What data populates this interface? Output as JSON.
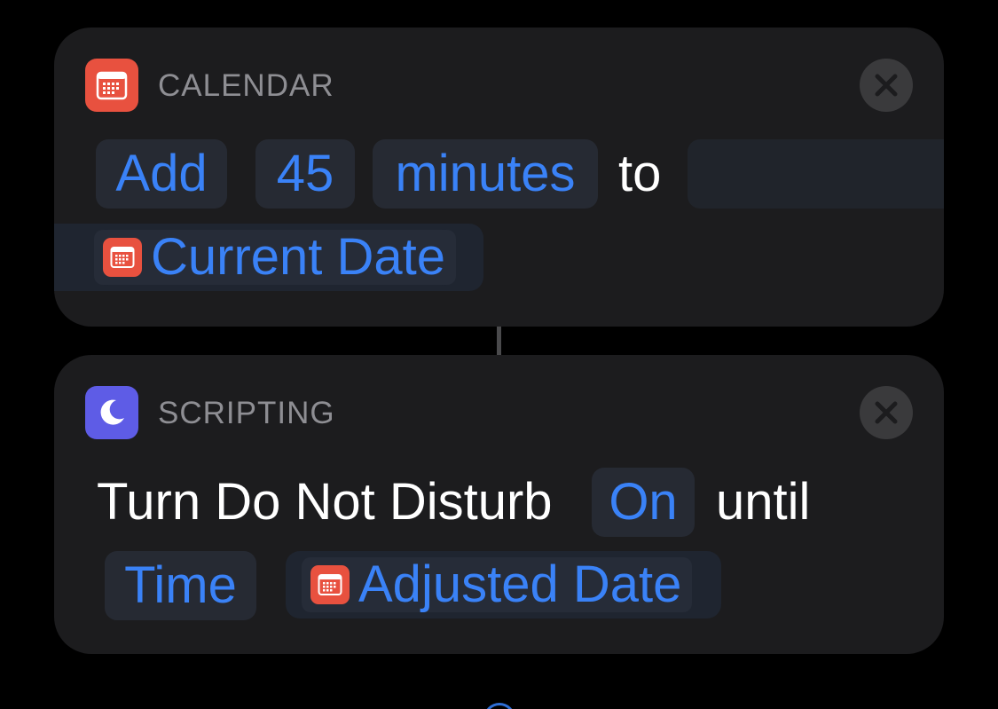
{
  "colors": {
    "background": "#000000",
    "card": "#1c1c1e",
    "token_text": "#3a82f7",
    "calendar_icon": "#e8513f",
    "scripting_icon": "#5e5ce6",
    "header_text": "#8e8e93"
  },
  "calendar_action": {
    "category": "CALENDAR",
    "icon": "calendar-icon",
    "operation_token": "Add",
    "amount_token": "45",
    "unit_token": "minutes",
    "connector_word": "to",
    "date_variable": {
      "label": "Current Date",
      "icon": "calendar-icon"
    },
    "close_icon": "close-icon"
  },
  "scripting_action": {
    "category": "SCRIPTING",
    "icon": "moon-icon",
    "text_prefix": "Turn Do Not Disturb",
    "state_token": "On",
    "until_word": "until",
    "mode_token": "Time",
    "date_variable": {
      "label": "Adjusted Date",
      "icon": "calendar-icon"
    },
    "close_icon": "close-icon"
  }
}
